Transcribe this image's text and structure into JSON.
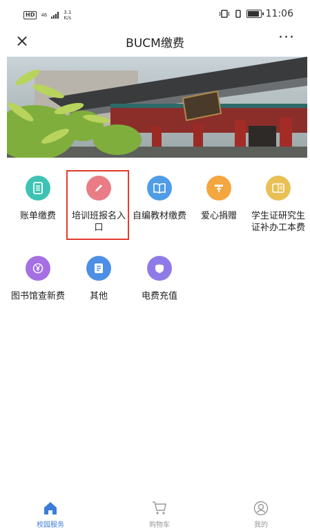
{
  "status_bar": {
    "hd": "HD",
    "signal_text": "46",
    "speed_value": "3.1",
    "speed_unit": "K/s",
    "time": "11:06"
  },
  "nav": {
    "close_label": "×",
    "title": "BUCM缴费",
    "more_label": "···"
  },
  "services": [
    {
      "label": "账单缴费",
      "icon": "bill-icon",
      "color": "#3dc3b3"
    },
    {
      "label": "培训班报名入口",
      "icon": "pencil-icon",
      "color": "#e97c86"
    },
    {
      "label": "自编教材缴费",
      "icon": "book-icon",
      "color": "#4f9de8"
    },
    {
      "label": "爱心捐赠",
      "icon": "donate-icon",
      "color": "#f4a640"
    },
    {
      "label": "学生证研究生证补办工本费",
      "icon": "id-card-icon",
      "color": "#e8c054"
    },
    {
      "label": "图书馆查新费",
      "icon": "yen-icon",
      "color": "#a570e3"
    },
    {
      "label": "其他",
      "icon": "document-icon",
      "color": "#4e8fe6"
    },
    {
      "label": "电费充值",
      "icon": "shield-icon",
      "color": "#8f7be8"
    }
  ],
  "tabbar": {
    "items": [
      {
        "label": "校园服务",
        "icon": "home-icon",
        "active": true
      },
      {
        "label": "购物车",
        "icon": "cart-icon",
        "active": false
      },
      {
        "label": "我的",
        "icon": "user-icon",
        "active": false
      }
    ],
    "active_color": "#3b7dd8"
  }
}
